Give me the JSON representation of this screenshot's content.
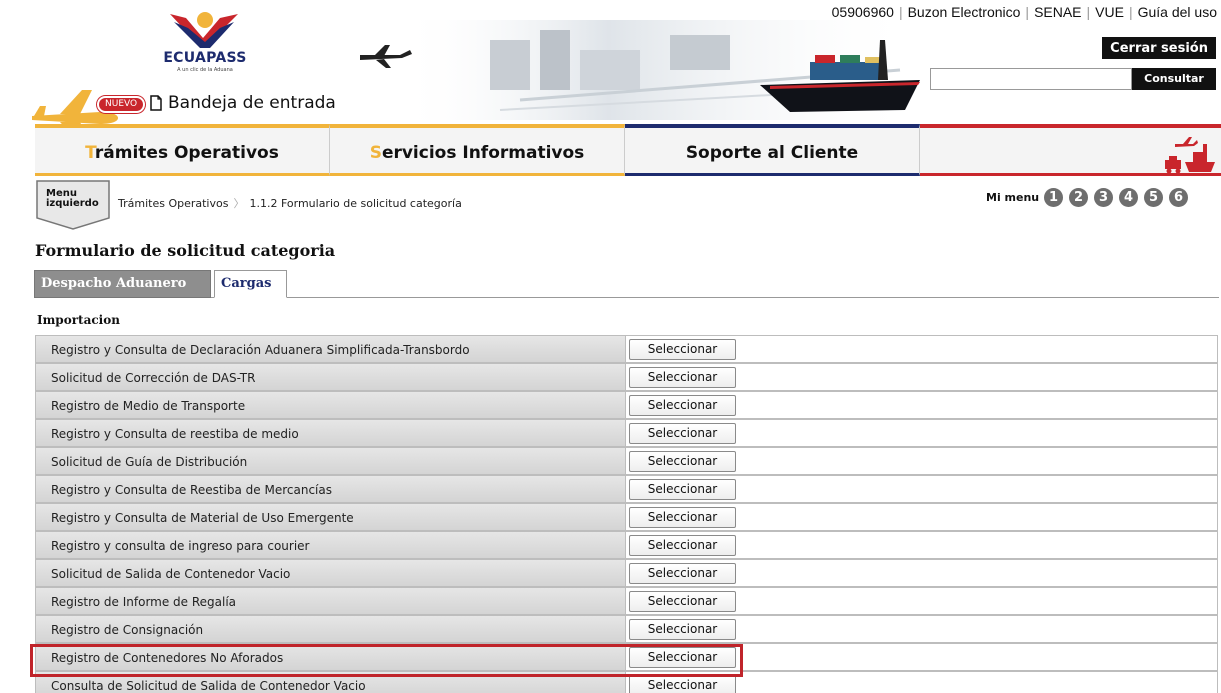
{
  "header": {
    "logo_text": "ECUAPASS",
    "logo_tagline": "A un clic de la Aduana",
    "nuevo_badge": "NUEVO",
    "inbox_label": "Bandeja de entrada",
    "top_links": [
      "05906960",
      "Buzon Electronico",
      "SENAE",
      "VUE",
      "Guía del uso"
    ],
    "logout_label": "Cerrar sesión",
    "search_value": "",
    "search_button_label": "Consultar"
  },
  "nav": {
    "items": [
      {
        "first": "T",
        "rest": "rámites Operativos"
      },
      {
        "first": "S",
        "rest": "ervicios Informativos"
      },
      {
        "first": "",
        "rest": "Soporte al Cliente"
      }
    ]
  },
  "crumbs": {
    "menu_left_line1": "Menu",
    "menu_left_line2": "izquierdo",
    "items": [
      "Trámites Operativos",
      "1.1.2 Formulario de solicitud categoría"
    ],
    "mimenu_label": "Mi menu",
    "mimenu_numbers": [
      "1",
      "2",
      "3",
      "4",
      "5",
      "6"
    ]
  },
  "page": {
    "title": "Formulario de solicitud categoria",
    "tabs": [
      "Despacho Aduanero",
      "Cargas"
    ],
    "active_tab": "Cargas",
    "section_heading": "Importacion"
  },
  "table": {
    "button_label": "Seleccionar",
    "rows": [
      "Registro y Consulta de Declaración Aduanera Simplificada-Transbordo",
      "Solicitud de Corrección de DAS-TR",
      "Registro de Medio de Transporte",
      "Registro y Consulta de reestiba de medio",
      "Solicitud de Guía de Distribución",
      "Registro y Consulta de Reestiba de Mercancías",
      "Registro y Consulta de Material de Uso Emergente",
      "Registro y consulta de ingreso para courier",
      "Solicitud de Salida de Contenedor Vacio",
      "Registro de Informe de Regalía",
      "Registro de Consignación",
      "Registro de Contenedores No Aforados",
      "Consulta de Solicitud de Salida de Contenedor Vacio"
    ],
    "highlighted_row": "Registro de Contenedores No Aforados"
  },
  "colors": {
    "brand_yellow": "#f1b43b",
    "brand_navy": "#1d2b6e",
    "brand_red": "#c9262c",
    "highlight": "#c0242a"
  }
}
